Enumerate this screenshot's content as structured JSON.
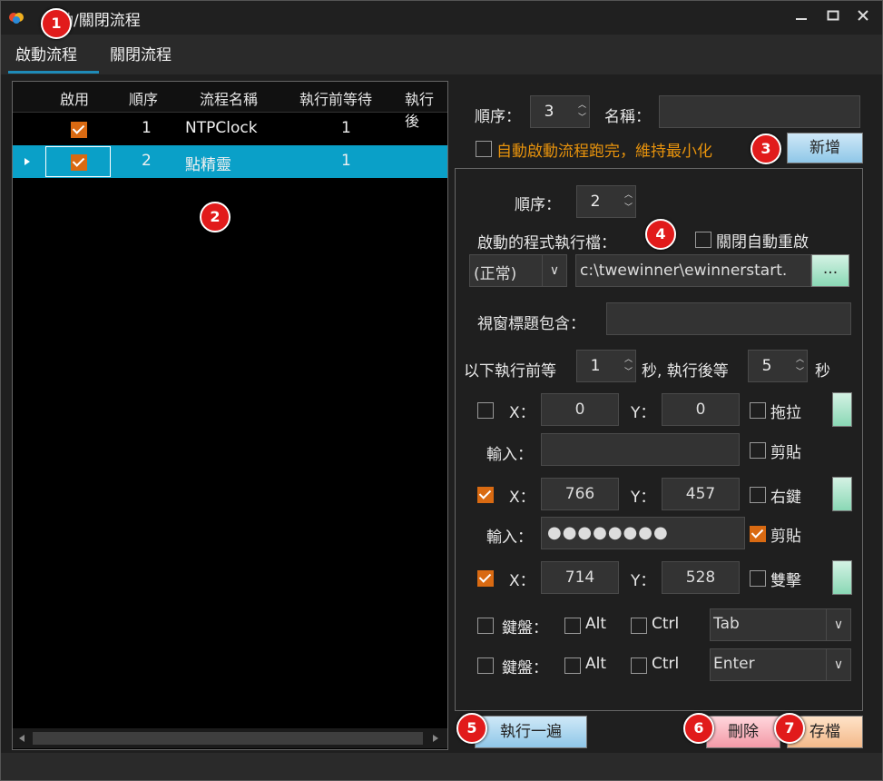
{
  "window": {
    "title": "啟動/關閉流程"
  },
  "tabs": [
    {
      "label": "啟動流程"
    },
    {
      "label": "關閉流程"
    }
  ],
  "grid": {
    "columns": [
      "啟用",
      "順序",
      "流程名稱",
      "執行前等待",
      "執行後"
    ],
    "rows": [
      {
        "enabled": true,
        "order": "1",
        "name": "NTPClock",
        "wait_before": "1"
      },
      {
        "enabled": true,
        "order": "2",
        "name": "點精靈",
        "wait_before": "1"
      }
    ]
  },
  "top_form": {
    "order_label": "順序：",
    "order_value": "3",
    "name_label": "名稱：",
    "name_value": "",
    "auto_min_label": "自動啟動流程跑完，維持最小化",
    "add_button": "新增"
  },
  "detail": {
    "order_label": "順序：",
    "order_value": "2",
    "exe_label": "啟動的程式執行檔：",
    "disable_restart_label": "關閉自動重啟",
    "window_mode": "(正常)",
    "exe_path": "c:\\twewinner\\ewinnerstart.",
    "browse_button": "...",
    "title_contains_label": "視窗標題包含：",
    "title_contains_value": "",
    "wait_before_label": "以下執行前等",
    "wait_before_value": "1",
    "wait_after_label": "秒, 執行後等",
    "wait_after_value": "5",
    "sec_label": "秒",
    "steps": [
      {
        "checked": false,
        "x_label": "X：",
        "x": "0",
        "y_label": "Y：",
        "y": "0",
        "action": "拖拉",
        "action_checked": false
      },
      {
        "input_label": "輸入：",
        "input": "",
        "action": "剪貼",
        "action_checked": false
      },
      {
        "checked": true,
        "x_label": "X：",
        "x": "766",
        "y_label": "Y：",
        "y": "457",
        "action": "右鍵",
        "action_checked": false
      },
      {
        "input_label": "輸入：",
        "input": "●●●●●●●●",
        "action": "剪貼",
        "action_checked": true
      },
      {
        "checked": true,
        "x_label": "X：",
        "x": "714",
        "y_label": "Y：",
        "y": "528",
        "action": "雙擊",
        "action_checked": false
      }
    ],
    "keyboard": [
      {
        "label": "鍵盤：",
        "alt": "Alt",
        "ctrl": "Ctrl",
        "key": "Tab"
      },
      {
        "label": "鍵盤：",
        "alt": "Alt",
        "ctrl": "Ctrl",
        "key": "Enter"
      }
    ]
  },
  "buttons": {
    "run_once": "執行一遍",
    "delete": "刪除",
    "save": "存檔"
  },
  "badges": [
    "1",
    "2",
    "3",
    "4",
    "5",
    "6",
    "7"
  ]
}
